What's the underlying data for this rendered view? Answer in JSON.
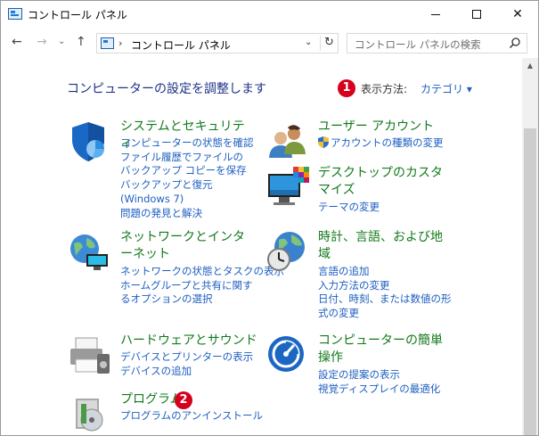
{
  "window": {
    "title": "コントロール パネル",
    "controls": {
      "minimize": "minimize",
      "maximize": "maximize",
      "close": "✕"
    }
  },
  "nav": {
    "back": "←",
    "forward": "→",
    "recent": "⌄",
    "up": "↑",
    "address_path": "コントロール パネル",
    "address_sep": "›",
    "address_dropdown": "⌄",
    "refresh": "↻",
    "search_placeholder": "コントロール パネルの検索"
  },
  "header": {
    "title": "コンピューターの設定を調整します",
    "view_by_label": "表示方法:",
    "view_by_value": "カテゴリ ▾"
  },
  "badges": [
    "1",
    "2"
  ],
  "categories": {
    "security": {
      "title": "システムとセキュリティ",
      "links": [
        "コンピューターの状態を確認",
        "ファイル履歴でファイルのバックアップ コピーを保存",
        "バックアップと復元 (Windows 7)",
        "問題の発見と解決"
      ]
    },
    "network": {
      "title": "ネットワークとインターネット",
      "links": [
        "ネットワークの状態とタスクの表示",
        "ホームグループと共有に関するオプションの選択"
      ]
    },
    "hardware": {
      "title": "ハードウェアとサウンド",
      "links": [
        "デバイスとプリンターの表示",
        "デバイスの追加"
      ]
    },
    "programs": {
      "title": "プログラム",
      "links": [
        "プログラムのアンインストール"
      ]
    },
    "users": {
      "title": "ユーザー アカウント",
      "links": [
        "アカウントの種類の変更"
      ]
    },
    "appearance": {
      "title": "デスクトップのカスタマイズ",
      "links": [
        "テーマの変更"
      ]
    },
    "clock": {
      "title": "時計、言語、および地域",
      "links": [
        "言語の追加",
        "入力方法の変更",
        "日付、時刻、または数値の形式の変更"
      ]
    },
    "ease": {
      "title": "コンピューターの簡単操作",
      "links": [
        "設定の提案の表示",
        "視覚ディスプレイの最適化"
      ]
    }
  },
  "colors": {
    "category_title": "#127a1b",
    "link": "#1e5fc1",
    "heading": "#1e3287",
    "badge": "#d6001c"
  }
}
